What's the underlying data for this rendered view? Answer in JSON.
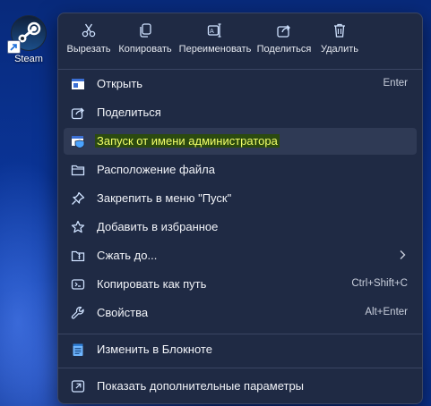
{
  "desktop": {
    "icon_label": "Steam"
  },
  "toolbar": {
    "cut_label": "Вырезать",
    "copy_label": "Копировать",
    "rename_label": "Переименовать",
    "share_label": "Поделиться",
    "delete_label": "Удалить"
  },
  "menu": {
    "items": [
      {
        "label": "Открыть",
        "shortcut": "Enter",
        "icon": "open-window-icon"
      },
      {
        "label": "Поделиться",
        "shortcut": "",
        "icon": "share-icon"
      },
      {
        "label": "Запуск от имени администратора",
        "shortcut": "",
        "icon": "shield-icon"
      },
      {
        "label": "Расположение файла",
        "shortcut": "",
        "icon": "folder-icon"
      },
      {
        "label": "Закрепить в меню \"Пуск\"",
        "shortcut": "",
        "icon": "pin-icon"
      },
      {
        "label": "Добавить в избранное",
        "shortcut": "",
        "icon": "star-icon"
      },
      {
        "label": "Сжать до...",
        "shortcut": "",
        "icon": "zip-folder-icon"
      },
      {
        "label": "Копировать как путь",
        "shortcut": "Ctrl+Shift+C",
        "icon": "copy-path-icon"
      },
      {
        "label": "Свойства",
        "shortcut": "Alt+Enter",
        "icon": "wrench-icon"
      },
      {
        "label": "Изменить в Блокноте",
        "shortcut": "",
        "icon": "notepad-icon"
      },
      {
        "label": "Показать дополнительные параметры",
        "shortcut": "",
        "icon": "more-options-icon"
      }
    ]
  },
  "colors": {
    "menu_bg": "#1f2a44",
    "highlight_text": "#f3ff6a",
    "accent_blue": "#4aa3ff"
  }
}
